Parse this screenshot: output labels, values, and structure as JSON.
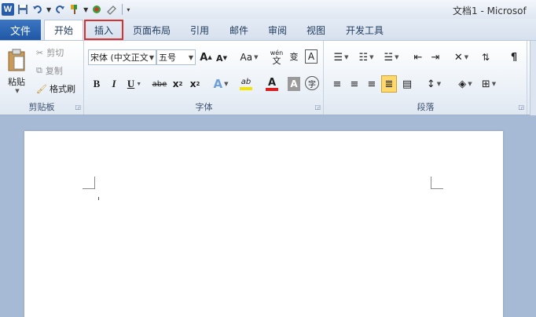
{
  "title_bar": {
    "window_title": "文档1 - Microsof",
    "qat_icons": [
      "word-logo",
      "save-icon",
      "undo-icon",
      "redo-icon",
      "format-painter-icon",
      "color-icon",
      "eraser-icon",
      "customize-icon"
    ],
    "logo_letter": "W"
  },
  "tabs": {
    "file": "文件",
    "items": [
      "开始",
      "插入",
      "页面布局",
      "引用",
      "邮件",
      "审阅",
      "视图",
      "开发工具"
    ],
    "active": "开始",
    "highlighted": "插入"
  },
  "clipboard": {
    "paste": "粘贴",
    "cut": "剪切",
    "copy": "复制",
    "format_painter": "格式刷",
    "label": "剪贴板"
  },
  "font": {
    "font_name": "宋体 (中文正文",
    "font_size": "五号",
    "grow": "A",
    "shrink": "A",
    "change_case": "Aa",
    "phonetic": "wén",
    "char_border": "A",
    "bold": "B",
    "italic": "I",
    "underline": "U",
    "strike": "abe",
    "subscript": "x",
    "superscript": "x",
    "text_effect": "A",
    "highlight": "ab",
    "font_color": "A",
    "char_shading": "A",
    "enclose": "字",
    "label": "字体"
  },
  "paragraph": {
    "label": "段落"
  },
  "colors": {
    "accent": "#2a5da9",
    "highlight_border": "#d93030",
    "font_color_bar": "#d92020",
    "highlight_bar": "#f2e600",
    "justify_active": "#ffd96b"
  }
}
